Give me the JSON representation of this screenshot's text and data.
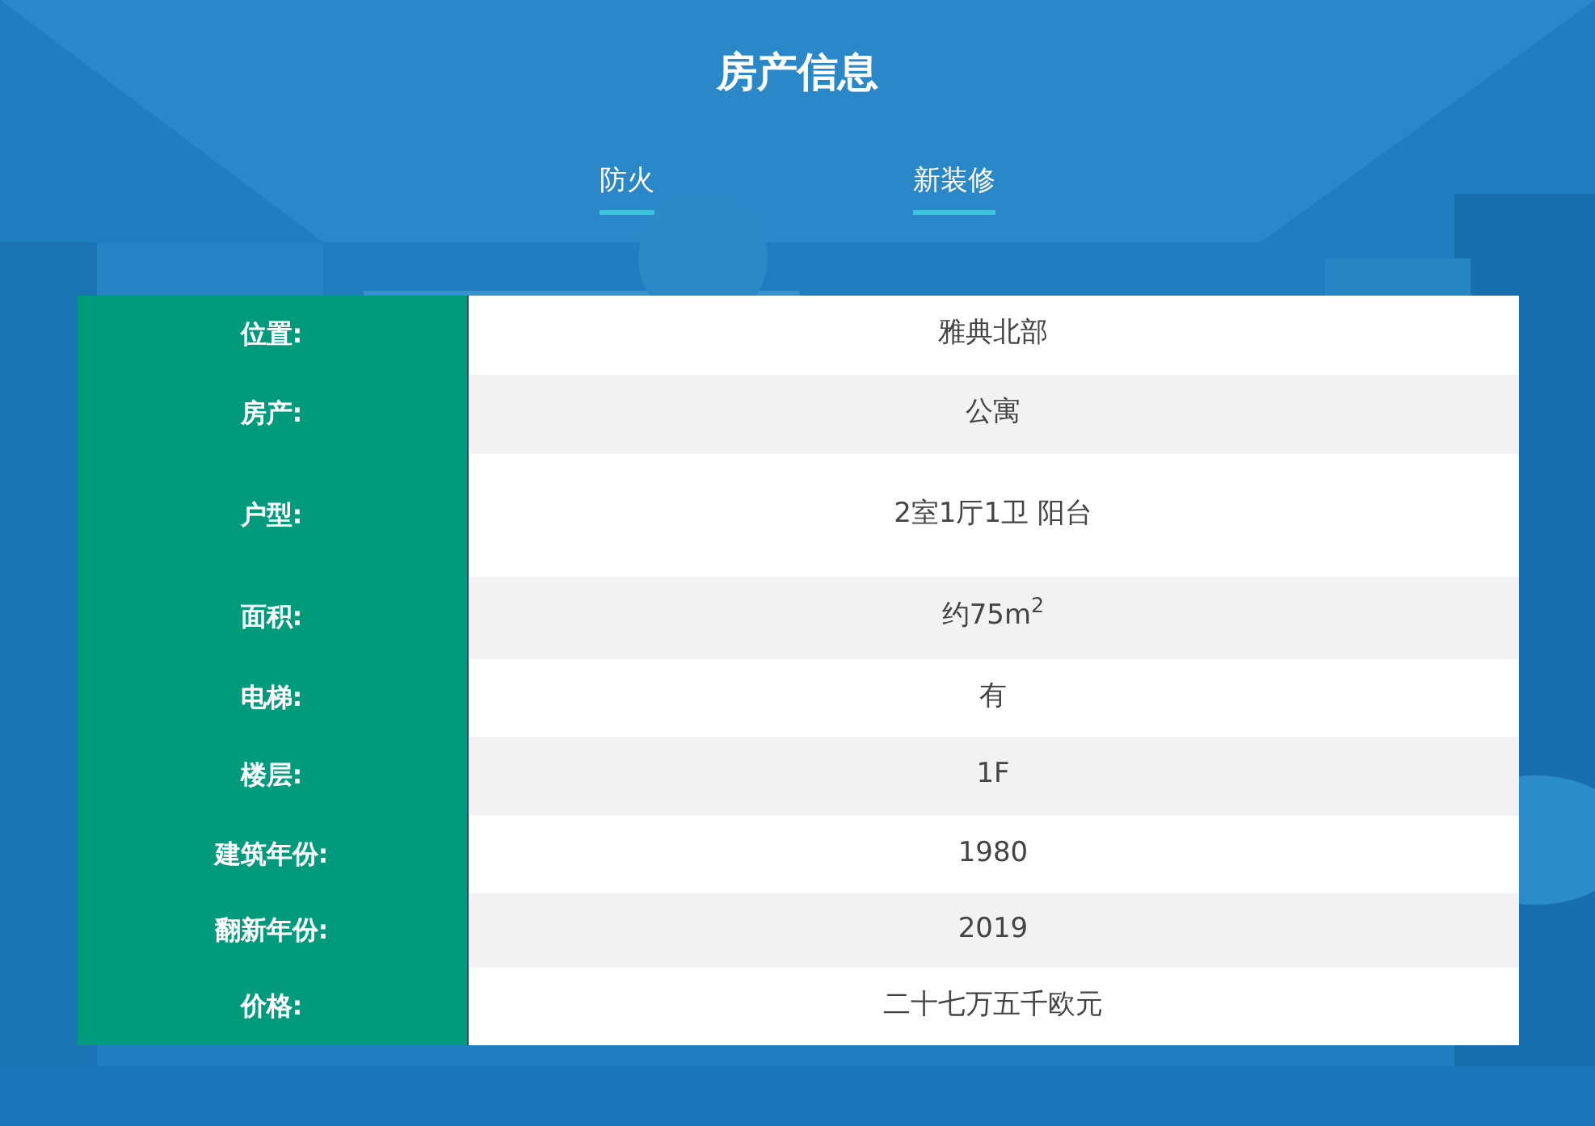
{
  "title": "房产信息",
  "features": [
    "防火",
    "新装修"
  ],
  "rows": [
    {
      "label": "位置:",
      "value": "雅典北部"
    },
    {
      "label": "房产:",
      "value": "公寓"
    },
    {
      "label": "户型:",
      "value": "2室1厅1卫 阳台"
    },
    {
      "label": "面积:",
      "value": "约75m$^{2}$"
    },
    {
      "label": "电梯:",
      "value": "有"
    },
    {
      "label": "楼层:",
      "value": "1F"
    },
    {
      "label": "建筑年份:",
      "value": "1980"
    },
    {
      "label": "翻新年份:",
      "value": "2019"
    },
    {
      "label": "价格:",
      "value": "二十七万五千欧元"
    }
  ]
}
